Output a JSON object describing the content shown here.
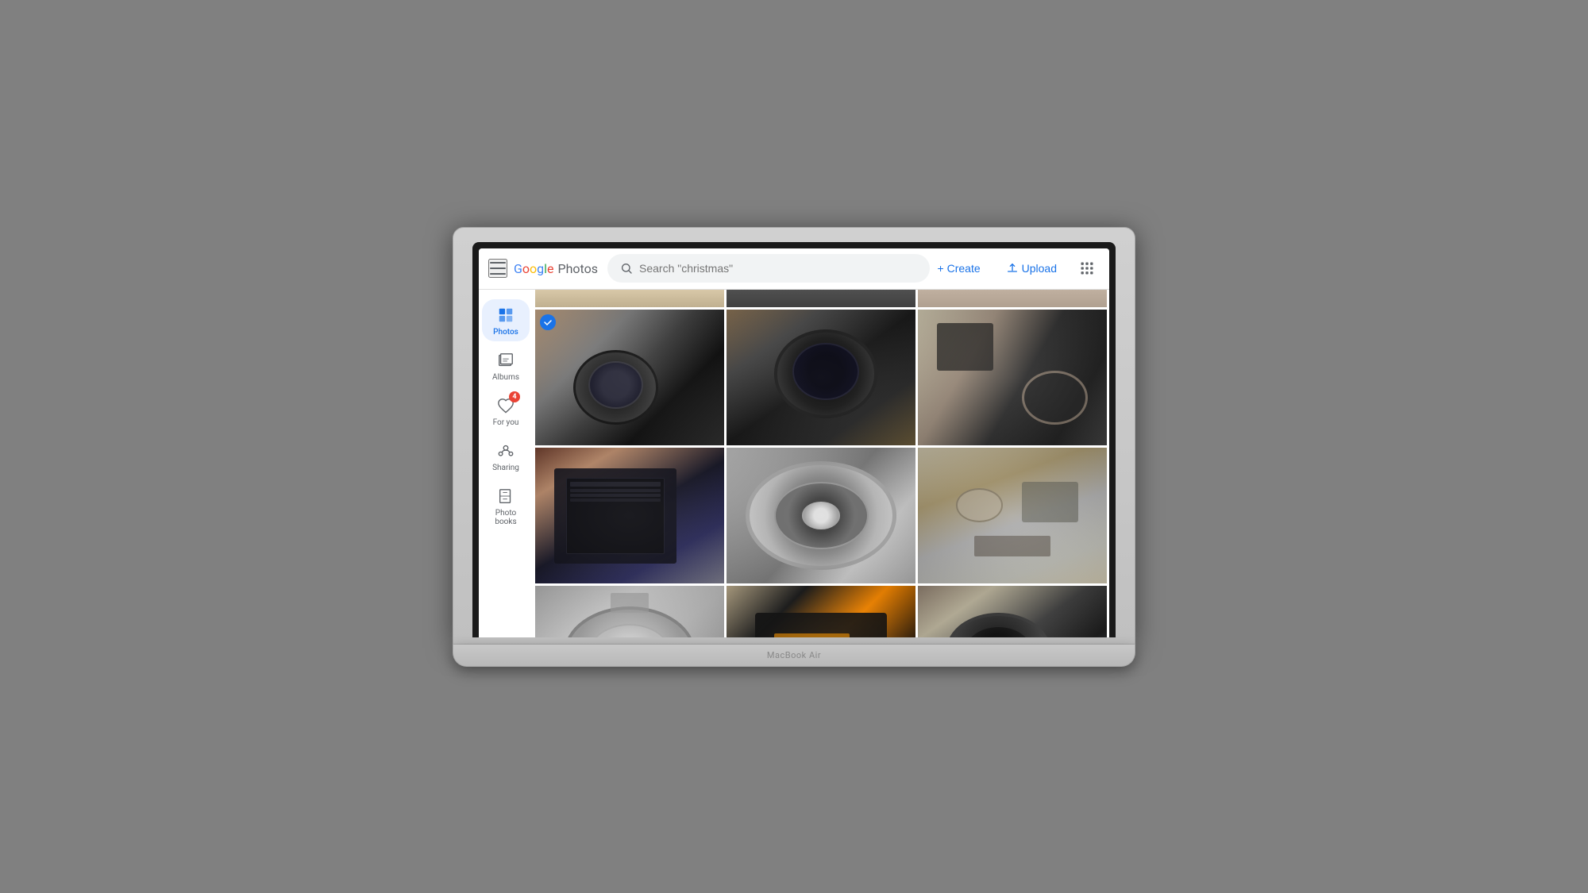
{
  "laptop": {
    "model": "MacBook Air"
  },
  "header": {
    "menu_label": "Menu",
    "logo_google": "Google",
    "logo_photos": "Photos",
    "search_placeholder": "Search \"christmas\"",
    "create_label": "+ Create",
    "upload_label": "Upload",
    "grid_label": "Google apps"
  },
  "sidebar": {
    "items": [
      {
        "id": "photos",
        "label": "Photos",
        "active": true,
        "badge": null
      },
      {
        "id": "albums",
        "label": "Albums",
        "active": false,
        "badge": null
      },
      {
        "id": "for-you",
        "label": "For you",
        "active": false,
        "badge": "4"
      },
      {
        "id": "sharing",
        "label": "Sharing",
        "active": false,
        "badge": null
      },
      {
        "id": "photo-books",
        "label": "Photo books",
        "active": false,
        "badge": null
      }
    ]
  },
  "photos": {
    "grid": [
      {
        "id": 1,
        "alt": "Camera top view angled",
        "checked": true,
        "class": "cam-1"
      },
      {
        "id": 2,
        "alt": "Camera front with lens close-up",
        "checked": false,
        "class": "cam-2"
      },
      {
        "id": 3,
        "alt": "Camera top partial side view",
        "checked": false,
        "class": "cam-3"
      },
      {
        "id": 4,
        "alt": "Camera back display settings",
        "checked": false,
        "class": "cam-4"
      },
      {
        "id": 5,
        "alt": "Camera silver lens close-up",
        "checked": false,
        "class": "cam-5"
      },
      {
        "id": 6,
        "alt": "Camera top plate view",
        "checked": false,
        "class": "cam-6"
      },
      {
        "id": 7,
        "alt": "Camera top dial close-up",
        "checked": false,
        "class": "cam-7"
      },
      {
        "id": 8,
        "alt": "Camera battery compartment open",
        "checked": false,
        "class": "cam-8"
      },
      {
        "id": 9,
        "alt": "Camera front angle on surface",
        "checked": false,
        "class": "cam-9"
      },
      {
        "id": 10,
        "alt": "Camera partial bottom row 1",
        "checked": false,
        "class": "cam-10"
      },
      {
        "id": 11,
        "alt": "Camera partial bottom row 2",
        "checked": false,
        "class": "cam-11"
      },
      {
        "id": 12,
        "alt": "Camera partial bottom row 3",
        "checked": false,
        "class": "cam-12"
      }
    ]
  }
}
